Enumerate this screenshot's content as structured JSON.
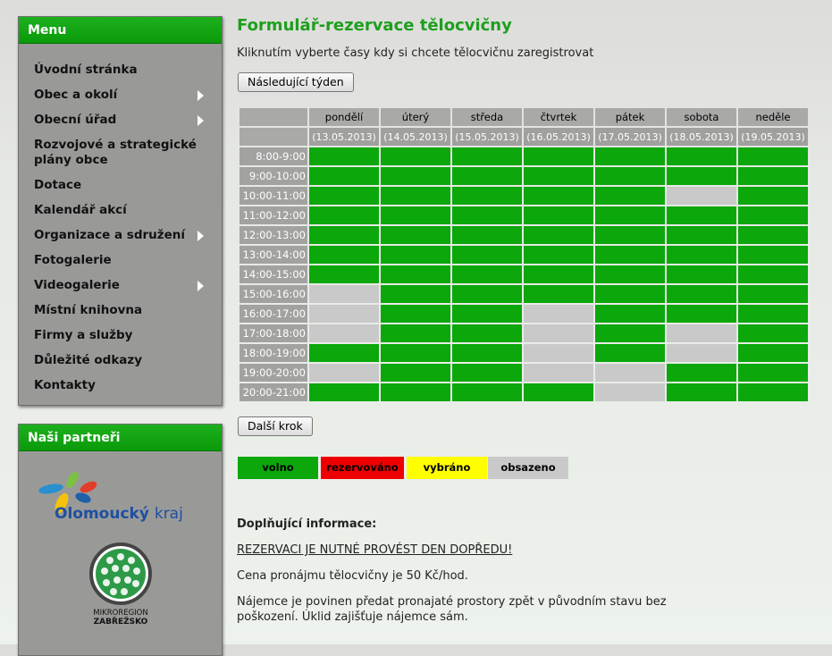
{
  "sidebar": {
    "menu_title": "Menu",
    "items": [
      {
        "label": "Úvodní stránka"
      },
      {
        "label": "Obec a okolí"
      },
      {
        "label": "Obecní úřad"
      },
      {
        "label": "Rozvojové a strategické plány obce"
      },
      {
        "label": "Dotace"
      },
      {
        "label": "Kalendář akcí"
      },
      {
        "label": "Organizace a sdružení"
      },
      {
        "label": "Fotogalerie"
      },
      {
        "label": "Videogalerie"
      },
      {
        "label": "Místní knihovna"
      },
      {
        "label": "Firmy a služby"
      },
      {
        "label": "Důležité odkazy"
      },
      {
        "label": "Kontakty"
      }
    ],
    "partners_title": "Naši partneři",
    "partners": {
      "olomoucky_name": "Olomoucký",
      "olomoucky_suffix": "kraj",
      "mikroregion_line1": "MIKROREGION",
      "mikroregion_line2": "ZABŘEŽSKO"
    }
  },
  "main": {
    "title": "Formulář-rezervace tělocvičny",
    "instruction": "Kliknutím vyberte časy kdy si chcete tělocvičnu zaregistrovat",
    "next_week_label": "Následující týden",
    "next_step_label": "Další krok",
    "days": [
      "pondělí",
      "úterý",
      "středa",
      "čtvrtek",
      "pátek",
      "sobota",
      "neděle"
    ],
    "dates": [
      "(13.05.2013)",
      "(14.05.2013)",
      "(15.05.2013)",
      "(16.05.2013)",
      "(17.05.2013)",
      "(18.05.2013)",
      "(19.05.2013)"
    ],
    "times": [
      "8:00-9:00",
      "9:00-10:00",
      "10:00-11:00",
      "11:00-12:00",
      "12:00-13:00",
      "13:00-14:00",
      "14:00-15:00",
      "15:00-16:00",
      "16:00-17:00",
      "17:00-18:00",
      "18:00-19:00",
      "19:00-20:00",
      "20:00-21:00"
    ],
    "slots": [
      [
        "volno",
        "volno",
        "volno",
        "volno",
        "volno",
        "volno",
        "volno"
      ],
      [
        "volno",
        "volno",
        "volno",
        "volno",
        "volno",
        "volno",
        "volno"
      ],
      [
        "volno",
        "volno",
        "volno",
        "volno",
        "volno",
        "obsazeno",
        "volno"
      ],
      [
        "volno",
        "volno",
        "volno",
        "volno",
        "volno",
        "volno",
        "volno"
      ],
      [
        "volno",
        "volno",
        "volno",
        "volno",
        "volno",
        "volno",
        "volno"
      ],
      [
        "volno",
        "volno",
        "volno",
        "volno",
        "volno",
        "volno",
        "volno"
      ],
      [
        "volno",
        "volno",
        "volno",
        "volno",
        "volno",
        "volno",
        "volno"
      ],
      [
        "obsazeno",
        "volno",
        "volno",
        "volno",
        "volno",
        "volno",
        "volno"
      ],
      [
        "obsazeno",
        "volno",
        "volno",
        "obsazeno",
        "volno",
        "volno",
        "volno"
      ],
      [
        "obsazeno",
        "volno",
        "volno",
        "obsazeno",
        "volno",
        "obsazeno",
        "volno"
      ],
      [
        "volno",
        "volno",
        "volno",
        "obsazeno",
        "volno",
        "obsazeno",
        "volno"
      ],
      [
        "obsazeno",
        "volno",
        "volno",
        "obsazeno",
        "obsazeno",
        "volno",
        "volno"
      ],
      [
        "volno",
        "volno",
        "volno",
        "volno",
        "obsazeno",
        "volno",
        "volno"
      ]
    ],
    "legend": [
      {
        "label": "volno",
        "color": "#0ba70b"
      },
      {
        "label": "rezervováno",
        "color": "#ee0000"
      },
      {
        "label": "vybráno",
        "color": "#ffff00"
      },
      {
        "label": "obsazeno",
        "color": "#c9c9c9"
      }
    ],
    "info": {
      "heading": "Doplňující informace:",
      "notice": "REZERVACI JE NUTNÉ PROVÉST DEN DOPŘEDU!",
      "price": "Cena pronájmu tělocvičny je 50 Kč/hod.",
      "rules": "Nájemce je povinen předat pronajaté prostory zpět v původním stavu bez poškození. Úklid zajišťuje nájemce sám."
    }
  }
}
